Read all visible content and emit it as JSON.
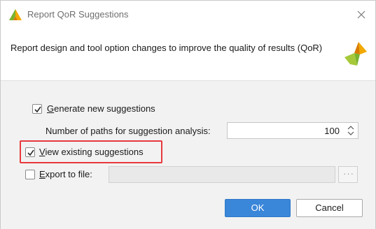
{
  "window": {
    "title": "Report QoR Suggestions"
  },
  "header": {
    "description": "Report design and tool option changes to improve the quality of results (QoR)"
  },
  "options": {
    "generate": {
      "label": "Generate new suggestions",
      "mnemonic": "G",
      "rest": "enerate new suggestions",
      "checked": true
    },
    "paths": {
      "label": "Number of paths for suggestion analysis:",
      "value": "100"
    },
    "view": {
      "label": "View existing suggestions",
      "mnemonic": "V",
      "rest": "iew existing suggestions",
      "checked": true
    },
    "export": {
      "label": "Export to file:",
      "mnemonic": "E",
      "rest": "xport to file:",
      "checked": false,
      "value": "",
      "browse_label": "···"
    }
  },
  "buttons": {
    "ok": "OK",
    "cancel": "Cancel"
  },
  "colors": {
    "accent": "#3a86d9",
    "highlight": "#e8383d",
    "logo": "#f2a900"
  },
  "icons": {
    "title": "vivado-logo-icon",
    "close": "close-icon",
    "brand": "vivado-logo-icon",
    "spinner": "spinner-arrows-icon",
    "check": "checkmark-icon"
  }
}
